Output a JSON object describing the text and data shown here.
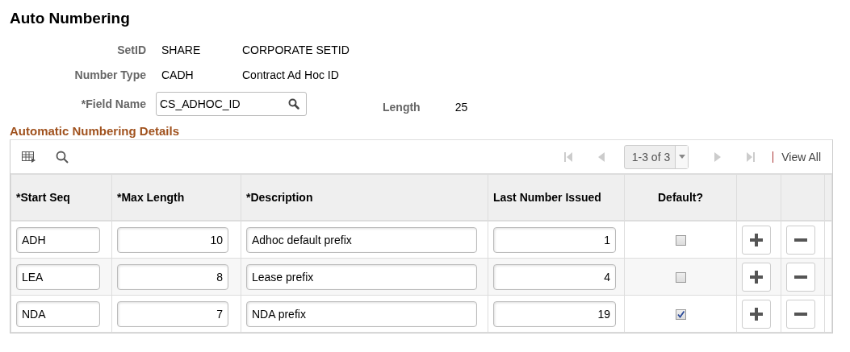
{
  "page_title": "Auto Numbering",
  "fields": [
    {
      "label": "SetID",
      "value": "SHARE",
      "description": "CORPORATE SETID"
    },
    {
      "label": "Number Type",
      "value": "CADH",
      "description": "Contract Ad Hoc ID"
    }
  ],
  "field_name": {
    "label": "*Field Name",
    "value": "CS_ADHOC_ID"
  },
  "length": {
    "label": "Length",
    "value": "25"
  },
  "grid": {
    "title": "Automatic Numbering Details",
    "pager": "1-3 of 3",
    "view_all": "View All",
    "columns": [
      "*Start Seq",
      "*Max Length",
      "*Description",
      "Last Number Issued",
      "Default?"
    ],
    "rows": [
      {
        "start_seq": "ADH",
        "max_length": "10",
        "description": "Adhoc default prefix",
        "last_number": "1",
        "default": false
      },
      {
        "start_seq": "LEA",
        "max_length": "8",
        "description": "Lease prefix",
        "last_number": "4",
        "default": false
      },
      {
        "start_seq": "NDA",
        "max_length": "7",
        "description": "NDA prefix",
        "last_number": "19",
        "default": true
      }
    ]
  }
}
